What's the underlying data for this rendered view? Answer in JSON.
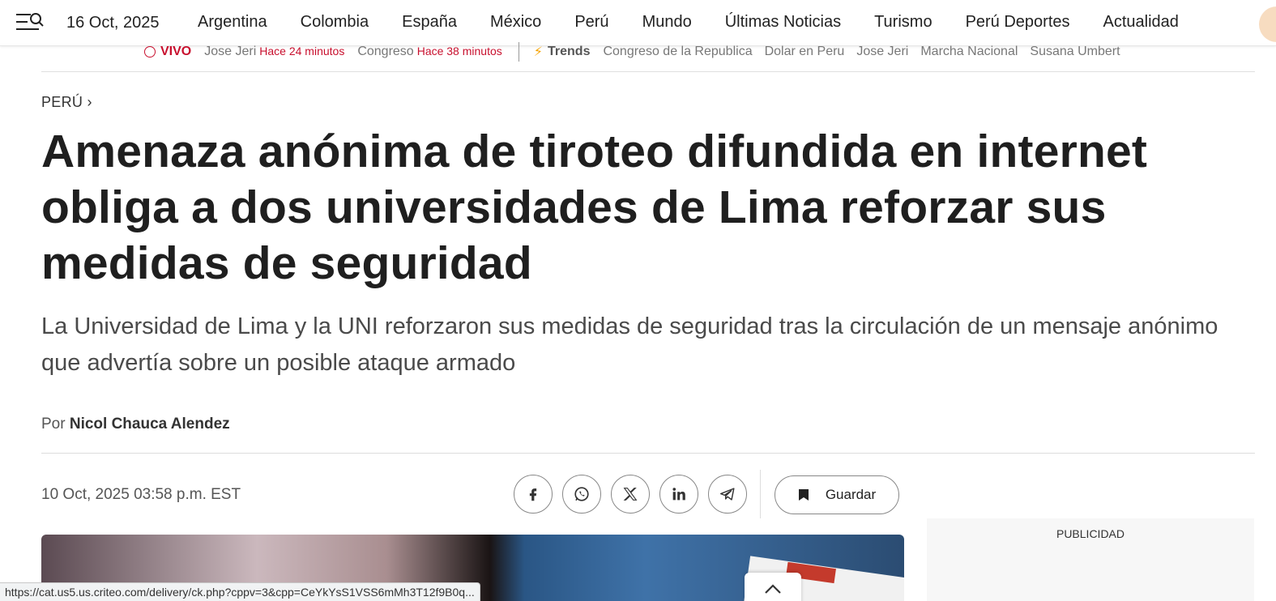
{
  "header": {
    "date": "16 Oct, 2025",
    "nav": [
      "Argentina",
      "Colombia",
      "España",
      "México",
      "Perú",
      "Mundo",
      "Últimas Noticias",
      "Turismo",
      "Perú Deportes",
      "Actualidad"
    ]
  },
  "ticker": {
    "live_label": "VIVO",
    "live_items": [
      {
        "title": "Jose Jeri",
        "ago": "Hace 24 minutos"
      },
      {
        "title": "Congreso",
        "ago": "Hace 38 minutos"
      }
    ],
    "trends_label": "Trends",
    "trends": [
      "Congreso de la Republica",
      "Dolar en Peru",
      "Jose Jeri",
      "Marcha Nacional",
      "Susana Umbert"
    ]
  },
  "article": {
    "section": "PERÚ",
    "headline": "Amenaza anónima de tiroteo difundida en internet obliga a dos universidades de Lima reforzar sus medidas de seguridad",
    "subheadline": "La Universidad de Lima y la UNI reforzaron sus medidas de seguridad tras la circulación de un mensaje anónimo que advertía sobre un posible ataque armado",
    "byline_prefix": "Por",
    "author": "Nicol Chauca Alendez",
    "published": "10 Oct, 2025 03:58 p.m. EST",
    "save_label": "Guardar"
  },
  "ad": {
    "label": "PUBLICIDAD"
  },
  "status_url": "https://cat.us5.us.criteo.com/delivery/ck.php?cppv=3&cpp=CeYkYsS1VSS6mMh3T12f9B0q..."
}
